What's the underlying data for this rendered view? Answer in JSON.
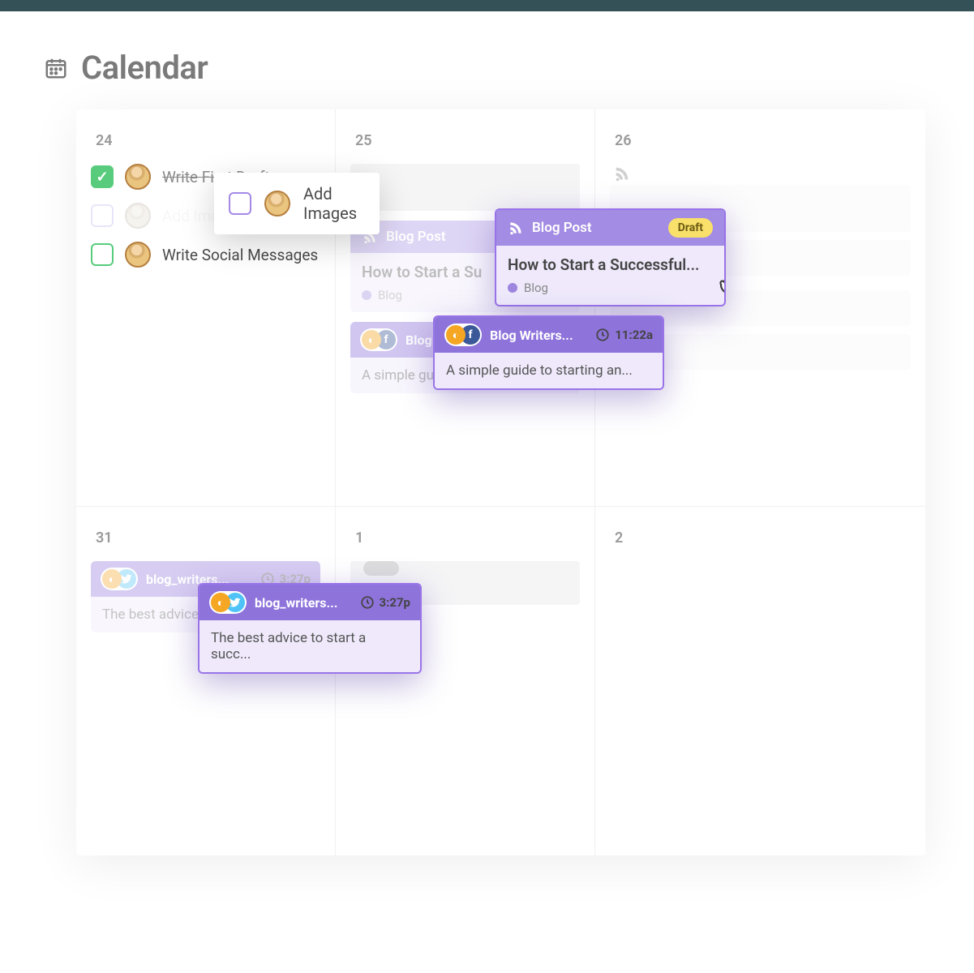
{
  "header": {
    "title": "Calendar"
  },
  "days": {
    "d24": "24",
    "d25": "25",
    "d26": "26",
    "d31": "31",
    "d1": "1",
    "d2": "2"
  },
  "tasks": {
    "t1": "Write First Draft",
    "t2_short": "Add Imag",
    "t2_full": "Add Images",
    "t3": "Write Social Messages"
  },
  "blog_card": {
    "label": "Blog Post",
    "status": "Draft",
    "title_full": "How to Start a Successful...",
    "title_short": "How to Start a Su",
    "category": "Blog"
  },
  "social1": {
    "account_full": "Blog Writers...",
    "account_short": "Blog V",
    "time": "11:22a",
    "text": "A simple guide to starting an..."
  },
  "social2": {
    "account": "blog_writers...",
    "time": "3:27p",
    "text_full": "The best advice to start a succ...",
    "text_short": "The best advice t"
  }
}
